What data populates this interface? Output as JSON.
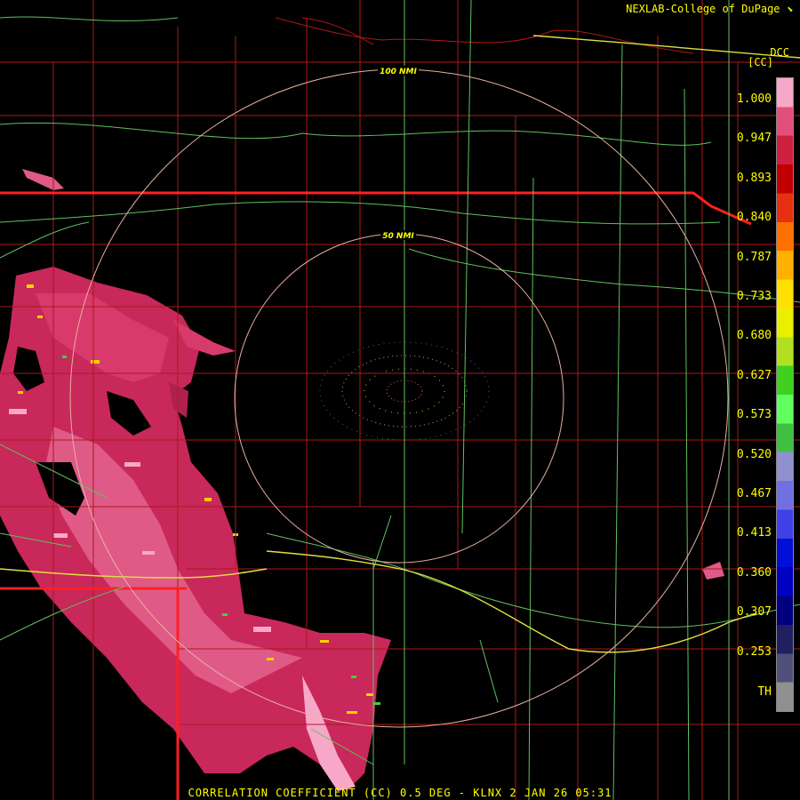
{
  "header": {
    "credit": "NEXLAB-College of DuPage",
    "credit_icon": "logo-arrow-icon"
  },
  "product": {
    "code": "DCC",
    "unit": "[CC]"
  },
  "colorbar": {
    "ticks": [
      "1.000",
      "0.947",
      "0.893",
      "0.840",
      "0.787",
      "0.733",
      "0.680",
      "0.627",
      "0.573",
      "0.520",
      "0.467",
      "0.413",
      "0.360",
      "0.307",
      "0.253"
    ],
    "threshold_label": "TH",
    "colors": [
      "#f7a8c8",
      "#e0507a",
      "#d02040",
      "#c00000",
      "#e83010",
      "#ff7000",
      "#ffb000",
      "#ffe000",
      "#e8f000",
      "#b0e020",
      "#40d020",
      "#60ff60",
      "#40c040",
      "#9090d0",
      "#7070e0",
      "#4040e8",
      "#0010d8",
      "#0000c0",
      "#000080",
      "#202060",
      "#505078",
      "#909090"
    ]
  },
  "rings": [
    {
      "label": "100 NMI",
      "range_nmi": 100
    },
    {
      "label": "50 NMI",
      "range_nmi": 50
    }
  ],
  "footer": {
    "title": "CORRELATION COEFFICIENT (CC) 0.5 DEG - KLNX 2 JAN 26 05:31"
  },
  "colors": {
    "text": "#ffff00",
    "county_lines": "#b01818",
    "state_lines": "#ff2020",
    "highways": "#60c060",
    "interstates": "#e0e040",
    "rings": "#e8b0a0"
  }
}
